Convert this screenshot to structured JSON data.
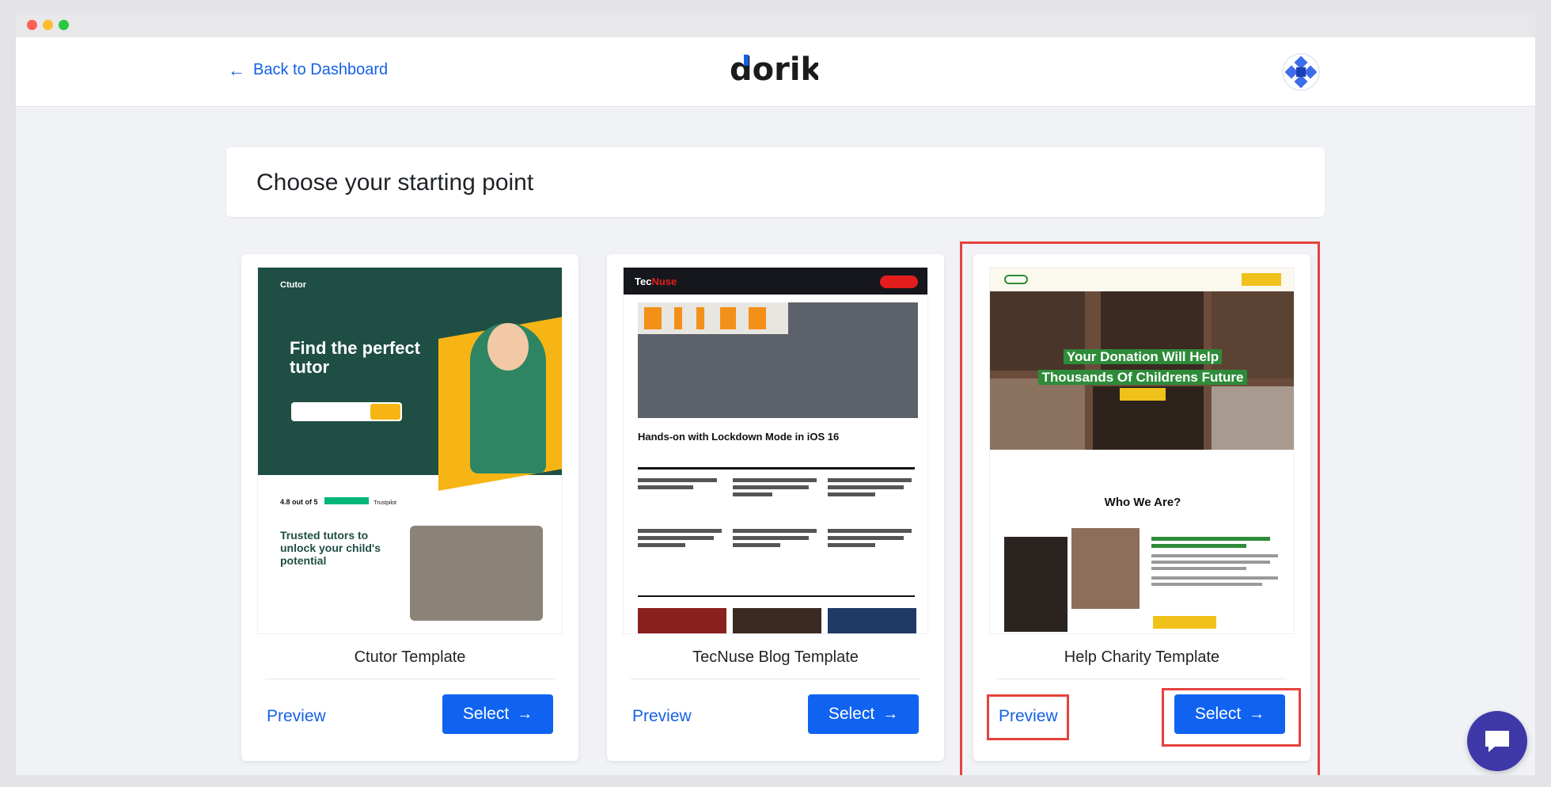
{
  "header": {
    "back_label": "Back to Dashboard",
    "logo_text": "dorik",
    "brand_color": "#1560e6"
  },
  "page": {
    "title": "Choose your starting point"
  },
  "templates": [
    {
      "name": "Ctutor Template",
      "preview_label": "Preview",
      "select_label": "Select",
      "thumb": {
        "brand": "Ctutor",
        "headline": "Find the perfect tutor",
        "rating": "4.8 out of 5",
        "rating_source": "Trustpilot",
        "subhead": "Trusted tutors to unlock your child's potential"
      }
    },
    {
      "name": "TecNuse Blog Template",
      "preview_label": "Preview",
      "select_label": "Select",
      "thumb": {
        "brand_a": "Tec",
        "brand_b": "Nuse",
        "headline": "Hands-on with Lockdown Mode in iOS 16"
      }
    },
    {
      "name": "Help Charity Template",
      "preview_label": "Preview",
      "select_label": "Select",
      "highlighted": true,
      "thumb": {
        "headline_line1": "Your Donation Will Help",
        "headline_line2": "Thousands Of Childrens Future",
        "section_title": "Who We Are?"
      }
    }
  ],
  "colors": {
    "select_button": "#1063f0",
    "highlight": "#e5433d",
    "chat": "#3f38a8"
  },
  "icons": {
    "back": "arrow-left-icon",
    "select": "arrow-right-icon",
    "chat": "chat-icon"
  }
}
